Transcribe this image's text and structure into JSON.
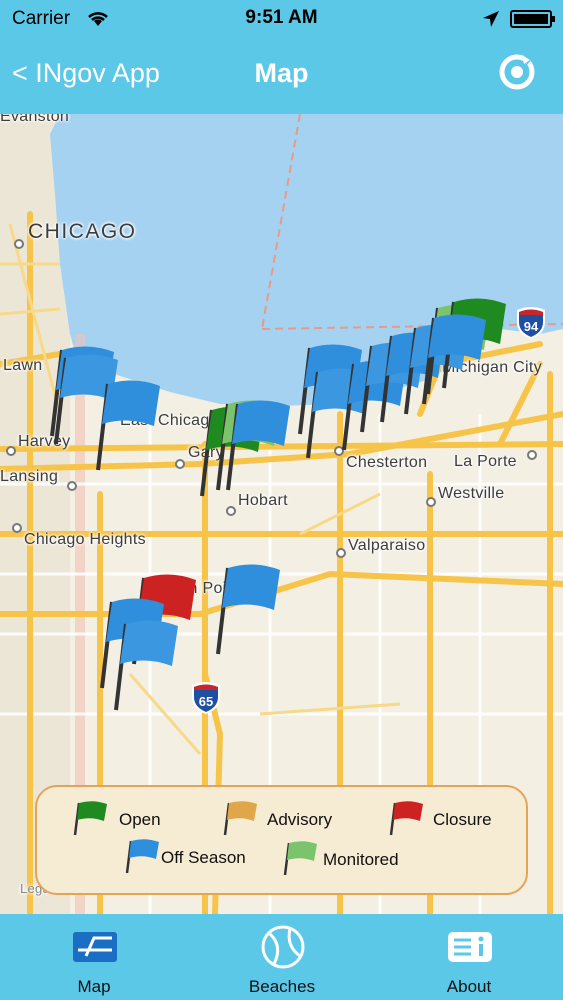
{
  "status_bar": {
    "carrier": "Carrier",
    "time": "9:51 AM"
  },
  "nav": {
    "back_label": "< INgov App",
    "title": "Map",
    "refresh_icon": "refresh-icon"
  },
  "map": {
    "places": {
      "evanston": "Evanston",
      "chicago": "CHICAGO",
      "lawn": "Lawn",
      "harvey": "Harvey",
      "lansing": "Lansing",
      "chicago_heights": "Chicago Heights",
      "east_chicago": "East Chicago",
      "gary": "Gary",
      "hobart": "Hobart",
      "chesterton": "Chesterton",
      "la_porte": "La Porte",
      "michigan_city": "Michigan City",
      "westville": "Westville",
      "valparaiso": "Valparaiso",
      "crown_point": "Crown Point",
      "legal": "Legal"
    },
    "shields": {
      "i94": "94",
      "i65": "65"
    },
    "colors": {
      "water": "#a6d2f2",
      "land": "#f3efe2",
      "road": "#f7c44a",
      "open": "#1f8a1f",
      "advisory": "#e0a64a",
      "closure": "#cc2222",
      "off_season": "#2f8fdc",
      "monitored": "#7cc46c"
    }
  },
  "legend": {
    "open": "Open",
    "advisory": "Advisory",
    "closure": "Closure",
    "off_season": "Off Season",
    "monitored": "Monitored"
  },
  "tabs": {
    "map": "Map",
    "beaches": "Beaches",
    "about": "About"
  }
}
